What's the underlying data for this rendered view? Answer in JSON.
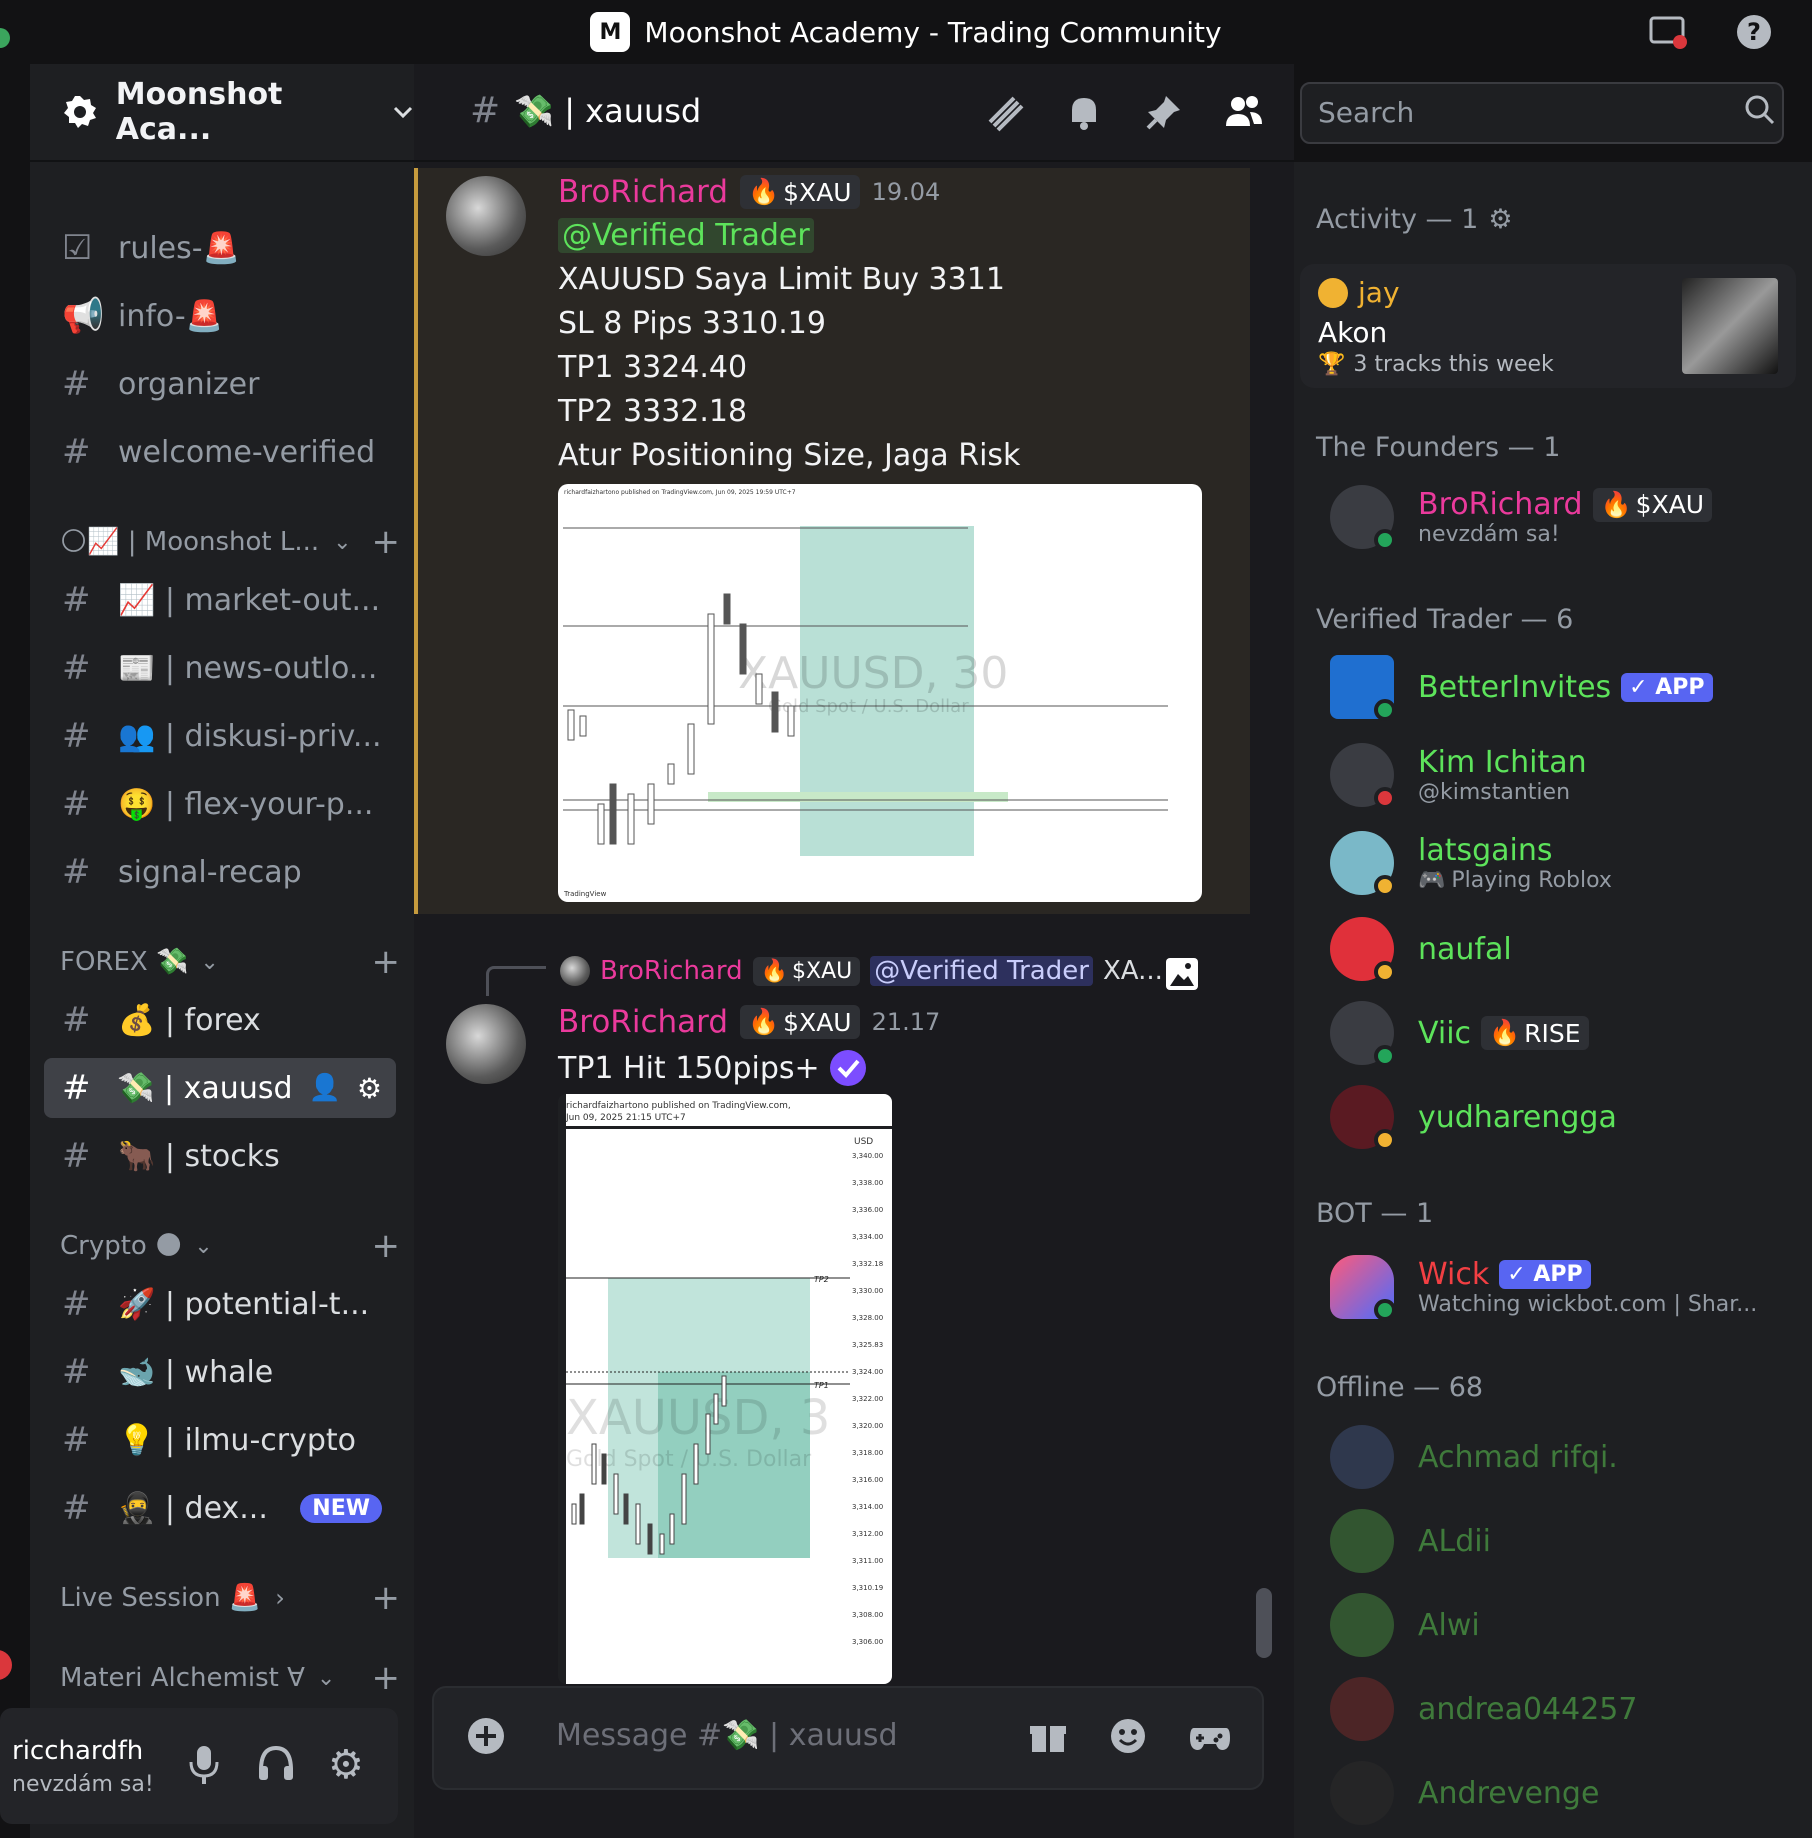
{
  "window": {
    "title": "Moonshot Academy - Trading Community"
  },
  "server": {
    "name": "Moonshot Aca..."
  },
  "channels": {
    "top": [
      {
        "label": "rules-🚨",
        "icon": "checklist-icon"
      },
      {
        "label": "info-🚨",
        "icon": "megaphone-icon"
      },
      {
        "label": "organizer",
        "icon": "hash-icon"
      },
      {
        "label": "welcome-verified",
        "icon": "hash-icon"
      }
    ],
    "cat1": {
      "label": "🌕📈 | Moonshot L..."
    },
    "cat1_items": [
      {
        "label": "📈 | market-out..."
      },
      {
        "label": "📰 | news-outlo..."
      },
      {
        "label": "👥 | diskusi-priv..."
      },
      {
        "label": "🤑 | flex-your-p..."
      },
      {
        "label": "signal-recap"
      }
    ],
    "forex": {
      "label": "FOREX 💸"
    },
    "forex_items": [
      {
        "label": "💰 | forex"
      },
      {
        "label": "💸 | xauusd"
      },
      {
        "label": "🐂 | stocks"
      }
    ],
    "crypto": {
      "label": "Crypto 🌑"
    },
    "crypto_items": [
      {
        "label": "🚀 | potential-t..."
      },
      {
        "label": "🐋 | whale"
      },
      {
        "label": "💡 | ilmu-crypto"
      },
      {
        "label": "🥷 | dex...",
        "badge": "NEW"
      }
    ],
    "live": {
      "label": "Live Session 🚨"
    },
    "materi": {
      "label": "Materi Alchemist ∀"
    }
  },
  "user": {
    "name": "ricchardfh",
    "status": "nevzdám sa!"
  },
  "chat_header": {
    "channel": "💸 | xauusd",
    "search_placeholder": "Search"
  },
  "messages": [
    {
      "author": "BroRichard",
      "tag": "$XAU",
      "time": "19.04",
      "mention": "@Verified Trader",
      "lines": [
        "XAUUSD Saya Limit Buy 3311",
        "SL 8 Pips 3310.19",
        "TP1 3324.40",
        "TP2 3332.18",
        "Atur Positioning Size, Jaga Risk"
      ],
      "image": {
        "watermark": "XAUUSD, 30",
        "sub": "Gold Spot / U.S. Dollar",
        "header": "richardfaizhartono published on TradingView.com, Jun 09, 2025 19:59 UTC+7",
        "footer": "TradingView"
      }
    },
    {
      "reply": {
        "author": "BroRichard",
        "tag": "$XAU",
        "mention": "@Verified Trader",
        "snippet": "XA..."
      },
      "author": "BroRichard",
      "tag": "$XAU",
      "time": "21.17",
      "text": "TP1 Hit 150pips+",
      "image": {
        "header1": "richardfaizhartono published on TradingView.com,",
        "header2": "Jun 09, 2025 21:15 UTC+7",
        "watermark": "XAUUSD, 3",
        "sub": "Gold Spot / U.S. Dollar",
        "currency": "USD",
        "ticks": [
          "3,340.00",
          "3,338.00",
          "3,336.00",
          "3,334.00",
          "3,332.18",
          "3,330.00",
          "3,328.00",
          "3,325.83",
          "3,324.00",
          "3,322.00",
          "3,320.00",
          "3,318.00",
          "3,316.00",
          "3,314.00",
          "3,312.00",
          "3,311.00",
          "3,310.19",
          "3,308.00",
          "3,306.00"
        ],
        "tp1": "TP1",
        "tp2": "TP2"
      }
    }
  ],
  "composer": {
    "placeholder": "Message #💸 | xauusd"
  },
  "members": {
    "activity": {
      "header": "Activity — 1",
      "name": "jay",
      "title": "Akon",
      "sub": "3 tracks this week"
    },
    "founders_header": "The Founders — 1",
    "founders": [
      {
        "name": "BroRichard",
        "tag": "$XAU",
        "sub": "nevzdám sa!"
      }
    ],
    "verified_header": "Verified Trader — 6",
    "verified": [
      {
        "name": "BetterInvites",
        "badge": "APP",
        "sub": ""
      },
      {
        "name": "Kim Ichitan",
        "sub": "@kimstantien"
      },
      {
        "name": "latsgains",
        "sub": "Playing Roblox"
      },
      {
        "name": "naufal",
        "sub": ""
      },
      {
        "name": "Viic",
        "tag": "RISE",
        "sub": ""
      },
      {
        "name": "yudharengga",
        "sub": ""
      }
    ],
    "bot_header": "BOT — 1",
    "bots": [
      {
        "name": "Wick",
        "badge": "APP",
        "sub": "Watching wickbot.com | Shar..."
      }
    ],
    "offline_header": "Offline — 68",
    "offline": [
      {
        "name": "Achmad rifqi."
      },
      {
        "name": "ALdii"
      },
      {
        "name": "Alwi"
      },
      {
        "name": "andrea044257"
      },
      {
        "name": "Andrevenge"
      }
    ]
  },
  "colors": {
    "accent": "#5865f2",
    "pink": "#ea3a9c",
    "green": "#5de35b",
    "highlight_border": "#c69b3e"
  }
}
